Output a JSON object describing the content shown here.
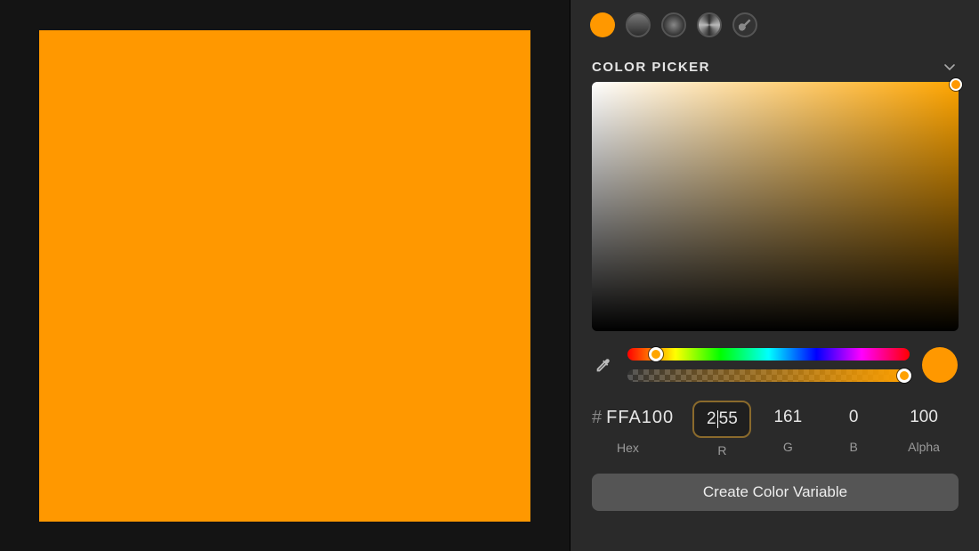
{
  "current_color": {
    "hex": "FFA100",
    "r": 255,
    "g": 161,
    "b": 0,
    "alpha": 100,
    "css": "#ff9800",
    "hue_css": "#ffa500"
  },
  "panel": {
    "title": "COLOR PICKER",
    "labels": {
      "hex": "Hex",
      "r": "R",
      "g": "G",
      "b": "B",
      "alpha": "Alpha"
    },
    "create_button": "Create Color Variable",
    "hash": "#"
  },
  "focused_field": "r"
}
